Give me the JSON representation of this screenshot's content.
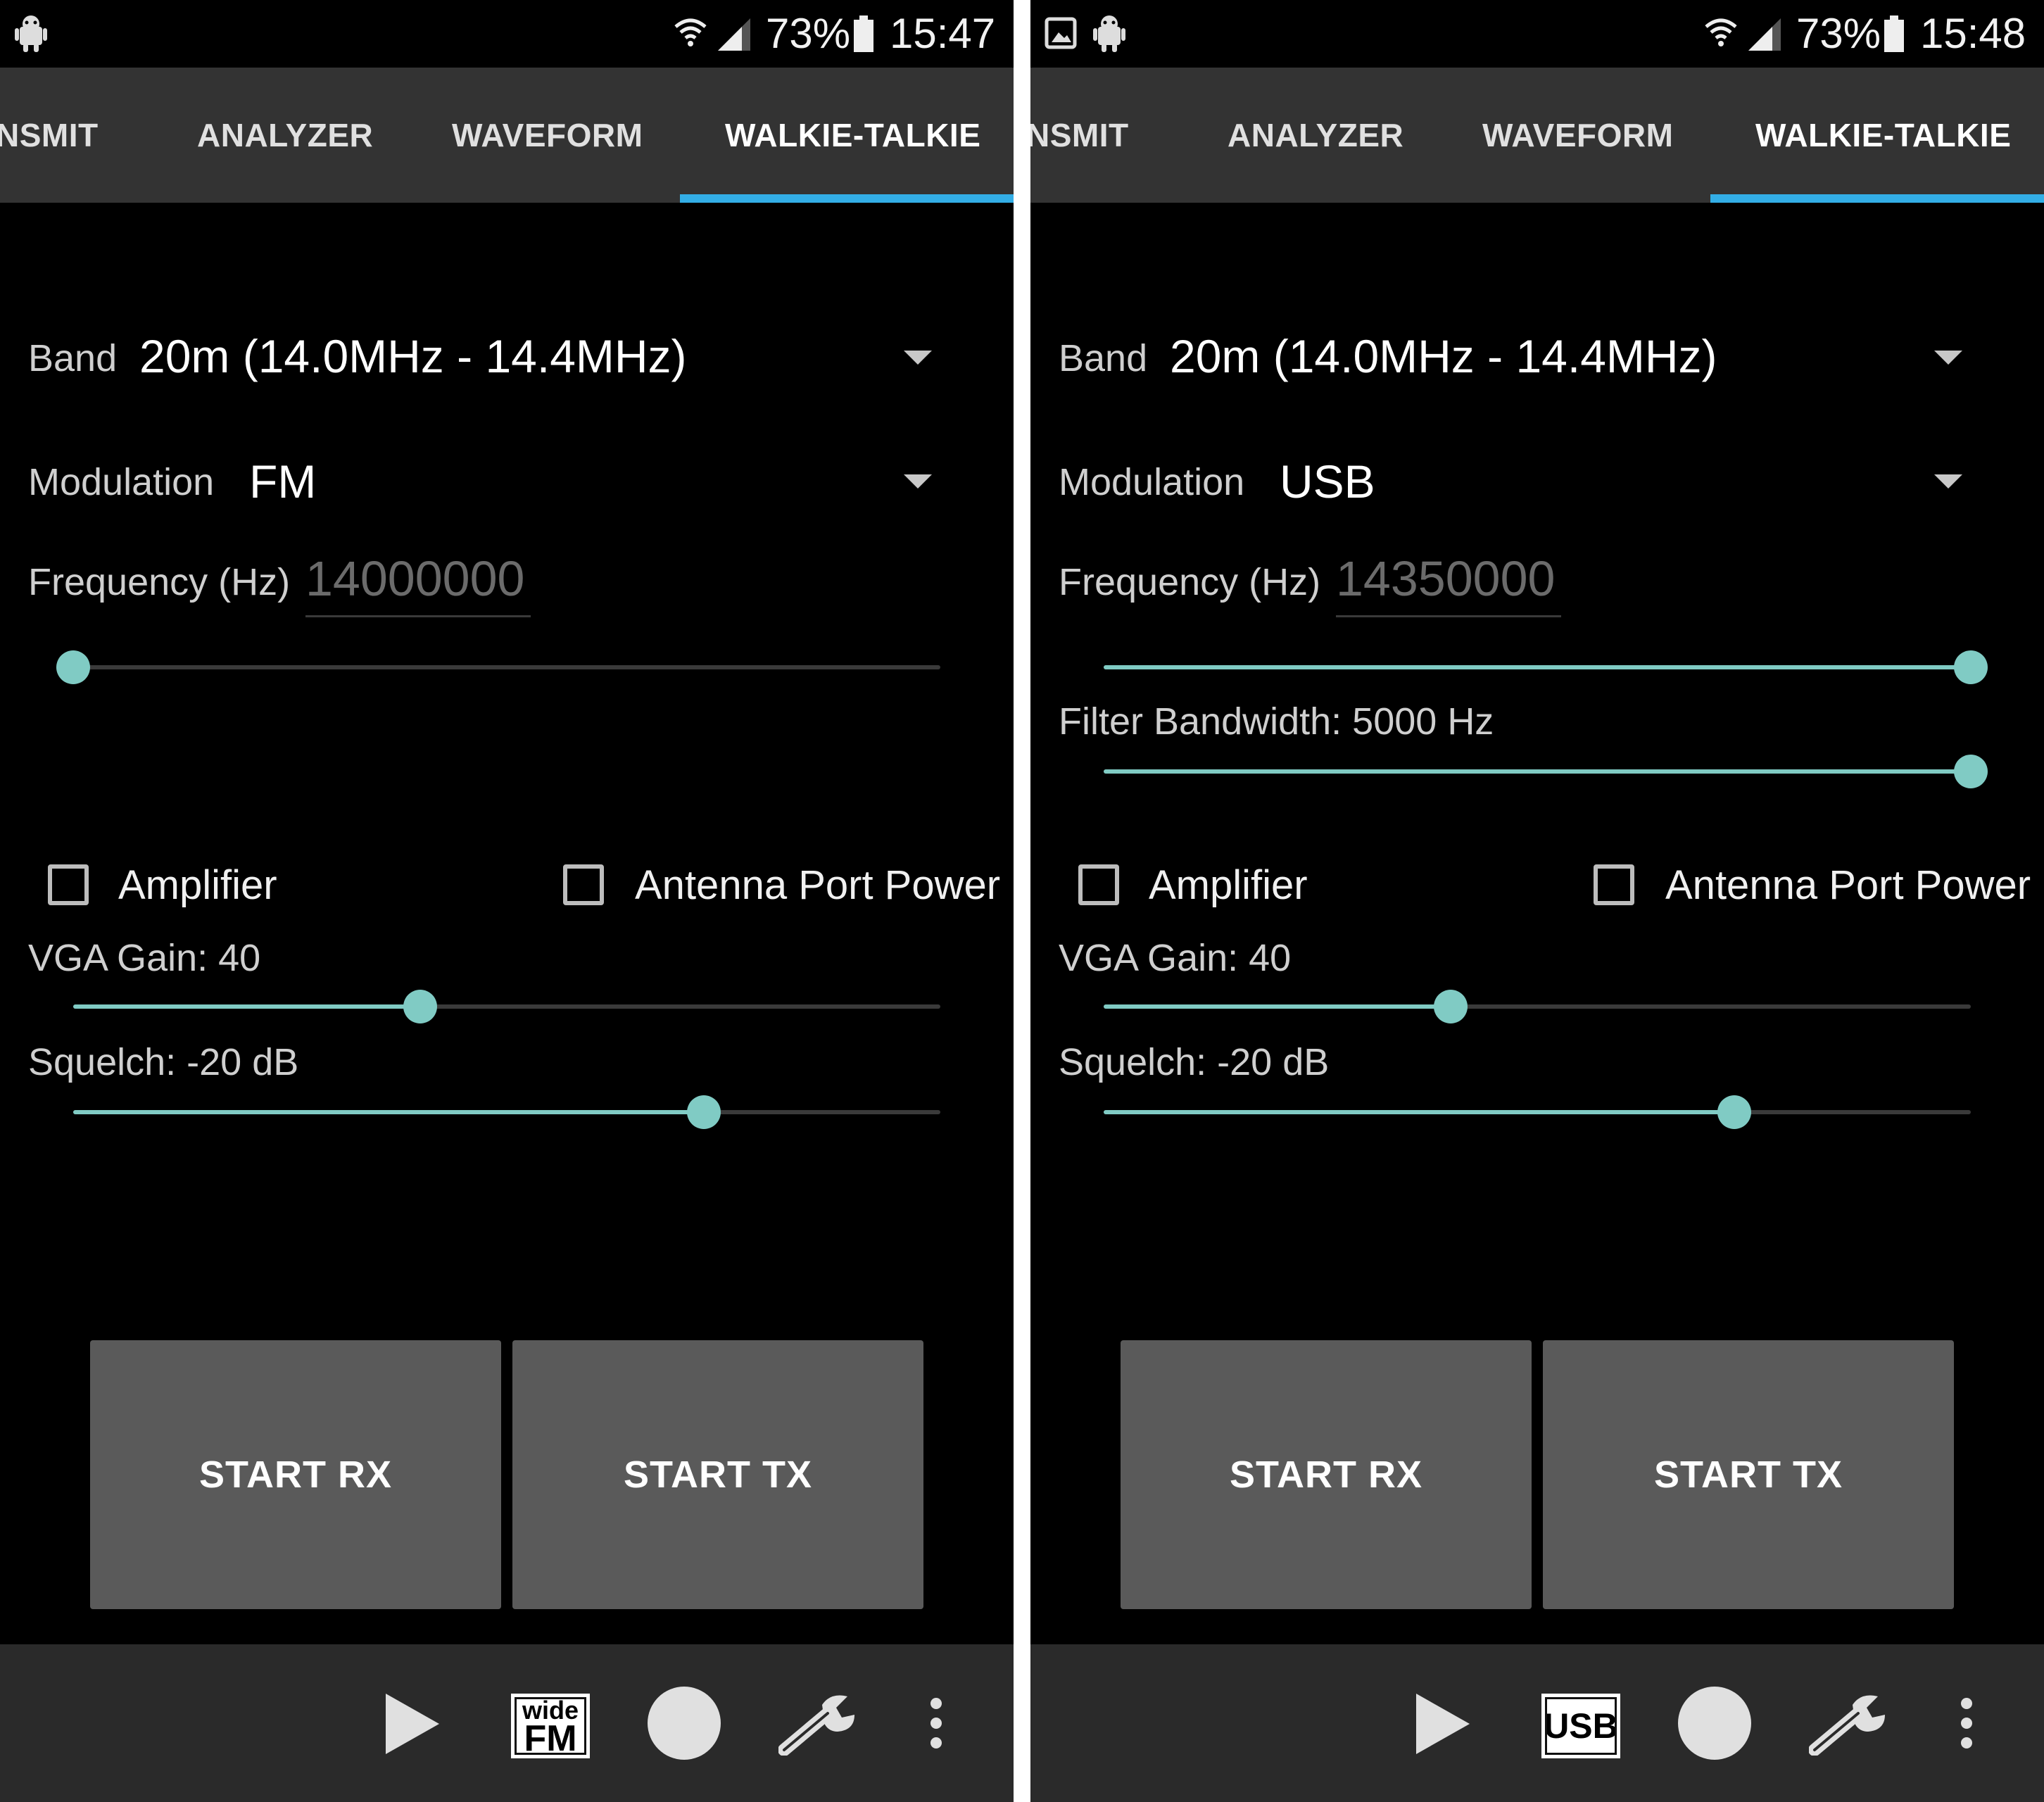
{
  "screens": [
    {
      "status": {
        "battery": "73%",
        "time": "15:47"
      },
      "tabs": [
        "NSMIT",
        "ANALYZER",
        "WAVEFORM",
        "WALKIE-TALKIE"
      ],
      "band": {
        "label": "Band",
        "value": "20m (14.0MHz - 14.4MHz)"
      },
      "modulation": {
        "label": "Modulation",
        "value": "FM"
      },
      "frequency": {
        "label": "Frequency (Hz)",
        "value": "14000000",
        "slider_fraction": 0.0
      },
      "amplifier": {
        "label": "Amplifier",
        "checked": false
      },
      "antenna": {
        "label": "Antenna Port Power",
        "checked": false
      },
      "vga_gain": {
        "label": "VGA Gain: 40",
        "slider_fraction": 0.4
      },
      "squelch": {
        "label": "Squelch: -20 dB",
        "slider_fraction": 0.727
      },
      "buttons": {
        "rx": "START RX",
        "tx": "START TX"
      },
      "mode_icon": {
        "line1": "wide",
        "line2": "FM"
      },
      "icons": [
        "android-icon",
        "wifi-icon",
        "signal-icon",
        "battery-icon",
        "play-icon",
        "record-icon",
        "wrench-icon",
        "more-icon"
      ]
    },
    {
      "status": {
        "battery": "73%",
        "time": "15:48"
      },
      "tabs": [
        "NSMIT",
        "ANALYZER",
        "WAVEFORM",
        "WALKIE-TALKIE"
      ],
      "band": {
        "label": "Band",
        "value": "20m (14.0MHz - 14.4MHz)"
      },
      "modulation": {
        "label": "Modulation",
        "value": "USB"
      },
      "frequency": {
        "label": "Frequency (Hz)",
        "value": "14350000",
        "slider_fraction": 1.0
      },
      "filter_bandwidth": {
        "label": "Filter Bandwidth: 5000 Hz",
        "slider_fraction": 1.0
      },
      "amplifier": {
        "label": "Amplifier",
        "checked": false
      },
      "antenna": {
        "label": "Antenna Port Power",
        "checked": false
      },
      "vga_gain": {
        "label": "VGA Gain: 40",
        "slider_fraction": 0.4
      },
      "squelch": {
        "label": "Squelch: -20 dB",
        "slider_fraction": 0.727
      },
      "buttons": {
        "rx": "START RX",
        "tx": "START TX"
      },
      "mode_icon": {
        "line1": "USB"
      },
      "icons": [
        "image-icon",
        "android-icon",
        "wifi-icon",
        "signal-icon",
        "battery-icon",
        "play-icon",
        "record-icon",
        "wrench-icon",
        "more-icon"
      ]
    }
  ]
}
